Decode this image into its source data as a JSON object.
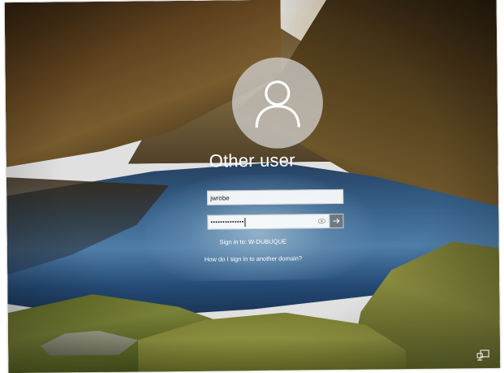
{
  "login": {
    "account_title": "Other user",
    "username_value": "jwrobe",
    "password_mask": "••••••••••••••",
    "sign_in_to_text": "Sign in to: W-DUBUQUE",
    "other_domain_link": "How do I sign in to another domain?"
  },
  "icons": {
    "avatar": "user-silhouette-icon",
    "reveal": "eye-icon",
    "submit": "arrow-right-icon",
    "corner": "network-icon"
  },
  "colors": {
    "text": "#ffffff",
    "field_bg": "#f4f4f4",
    "submit_bg": "#7a7a7a"
  }
}
